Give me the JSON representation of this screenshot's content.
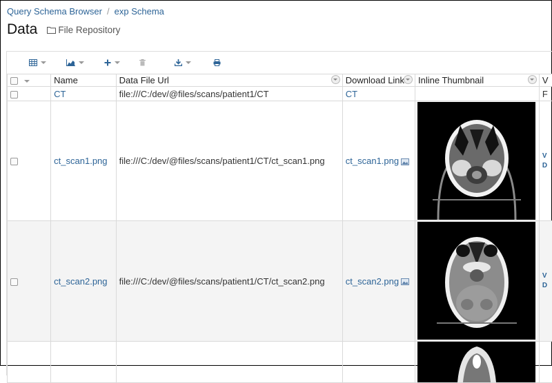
{
  "breadcrumb": {
    "items": [
      "Query Schema Browser",
      "exp Schema"
    ]
  },
  "page": {
    "title": "Data",
    "subtitle": "File Repository"
  },
  "columns": {
    "name": "Name",
    "data_file_url": "Data File Url",
    "download_link": "Download Link",
    "inline_thumbnail": "Inline Thumbnail",
    "next": "V"
  },
  "rows": [
    {
      "name": "CT",
      "url": "file:///C:/dev/@files/scans/patient1/CT",
      "download": "CT",
      "cut": "F"
    },
    {
      "name": "ct_scan1.png",
      "url": "file:///C:/dev/@files/scans/patient1/CT/ct_scan1.png",
      "download": "ct_scan1.png",
      "cut1": "V",
      "cut2": "D"
    },
    {
      "name": "ct_scan2.png",
      "url": "file:///C:/dev/@files/scans/patient1/CT/ct_scan2.png",
      "download": "ct_scan2.png",
      "cut1": "V",
      "cut2": "D"
    }
  ],
  "colors": {
    "link": "#2d6497",
    "border": "#d9d9d9",
    "alt_row": "#f4f4f4"
  },
  "icons": [
    "grid-view-icon",
    "chart-icon",
    "plus-icon",
    "trash-icon",
    "download-icon",
    "print-icon",
    "folder-icon",
    "image-file-icon"
  ]
}
